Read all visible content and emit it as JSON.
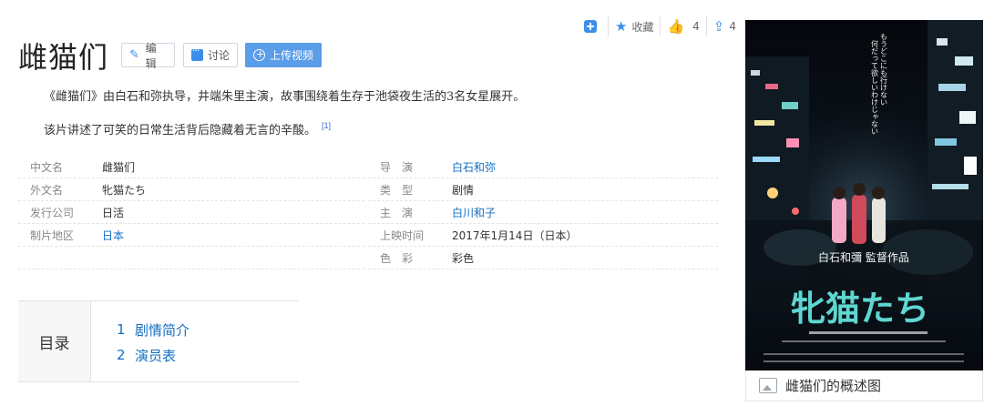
{
  "actions": {
    "collect_label": "收藏",
    "like_count": "4",
    "share_count": "4"
  },
  "title": "雌猫们",
  "buttons": {
    "edit": "编辑",
    "discuss": "讨论",
    "upload": "上传视频"
  },
  "summary": {
    "p1": "《雌猫们》由白石和弥执导，井端朱里主演，故事围绕着生存于池袋夜生活的3名女星展开。",
    "p2": "该片讲述了可笑的日常生活背后隐藏着无言的辛酸。",
    "p2_ref": "[1]"
  },
  "info_left": [
    {
      "key": "中文名",
      "value": "雌猫们",
      "link": false
    },
    {
      "key": "外文名",
      "value": "牝猫たち",
      "link": false
    },
    {
      "key": "发行公司",
      "value": "日活",
      "link": false
    },
    {
      "key": "制片地区",
      "value": "日本",
      "link": true
    }
  ],
  "info_right": [
    {
      "key": "导　演",
      "value": "白石和弥",
      "link": true
    },
    {
      "key": "类　型",
      "value": "剧情",
      "link": false
    },
    {
      "key": "主　演",
      "value": "白川和子",
      "link": true
    },
    {
      "key": "上映时间",
      "value": "2017年1月14日（日本）",
      "link": false
    },
    {
      "key": "色　彩",
      "value": "彩色",
      "link": false
    }
  ],
  "catalog": {
    "title": "目录",
    "items": [
      {
        "num": "1",
        "label": "剧情简介"
      },
      {
        "num": "2",
        "label": "演员表"
      }
    ]
  },
  "poster": {
    "title_text": "牝猫たち",
    "director_text": "白石和彌 監督作品",
    "caption": "雌猫们的概述图"
  },
  "colors": {
    "link": "#136ec2",
    "accent": "#3d8ee8",
    "upload_button": "#5a9de8"
  }
}
